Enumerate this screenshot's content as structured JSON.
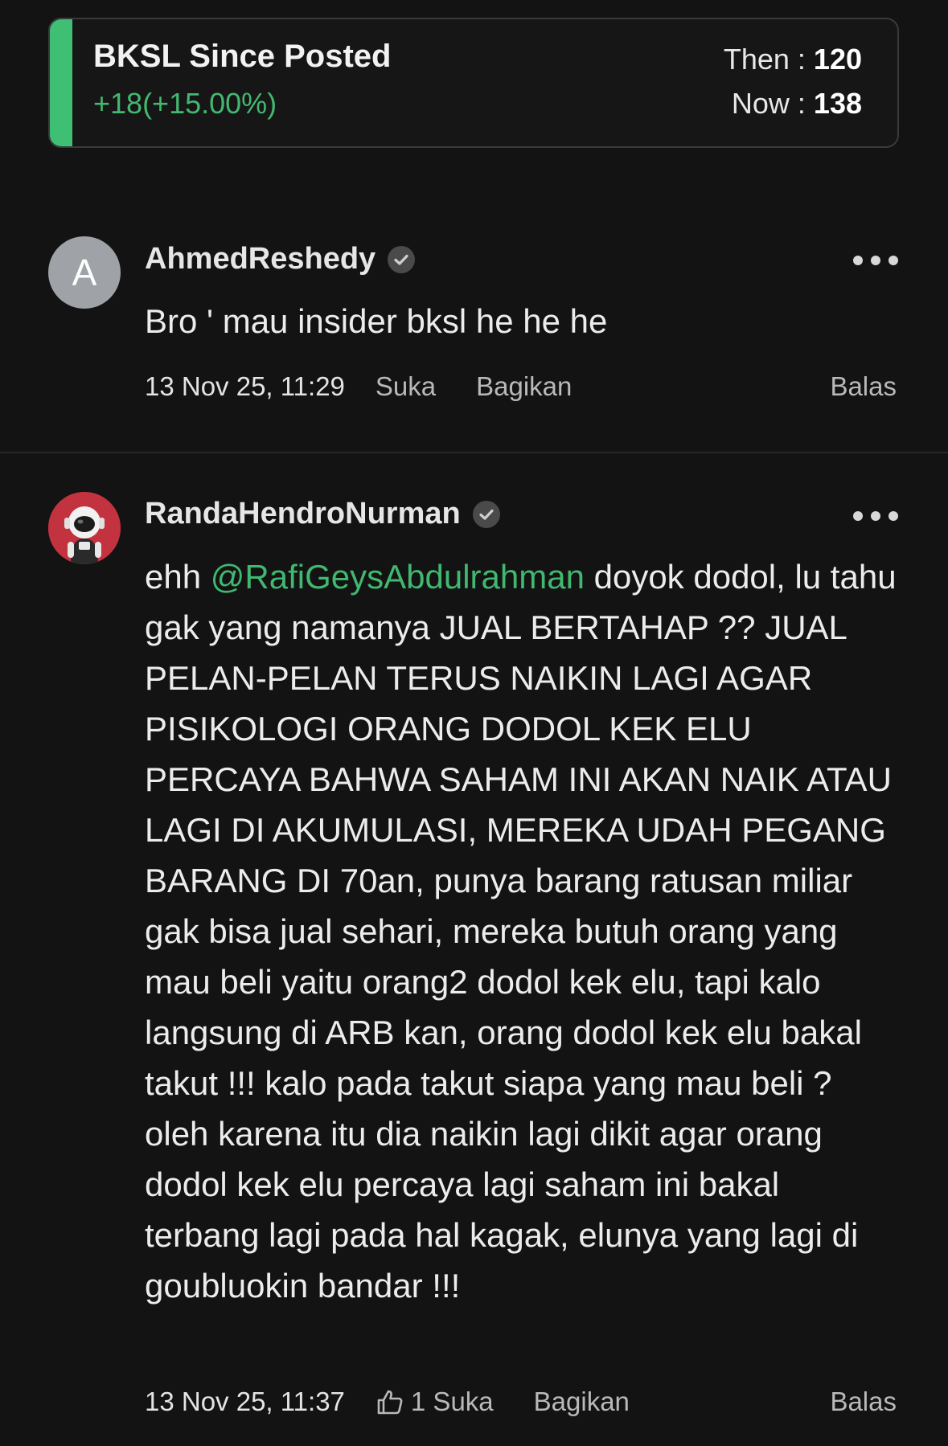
{
  "stock_card": {
    "title": "BKSL Since Posted",
    "change": "+18(+15.00%)",
    "then_label": "Then : ",
    "then_value": "120",
    "now_label": "Now : ",
    "now_value": "138",
    "accent_color": "#3fbf74"
  },
  "comments": [
    {
      "avatar_letter": "A",
      "username": "AhmedReshedy",
      "verified_icon": "verified-check-icon",
      "text": "Bro ' mau insider bksl he he he",
      "timestamp": "13 Nov 25, 11:29",
      "like_label": "Suka",
      "share_label": "Bagikan",
      "reply_label": "Balas"
    },
    {
      "avatar_icon": "astronaut-avatar",
      "username": "RandaHendroNurman",
      "verified_icon": "verified-check-icon",
      "text_prefix": "ehh ",
      "mention": "@RafiGeysAbdulrahman",
      "text": " doyok dodol, lu tahu gak yang namanya JUAL BERTAHAP ?? JUAL PELAN-PELAN TERUS NAIKIN LAGI AGAR PISIKOLOGI ORANG DODOL KEK ELU PERCAYA BAHWA SAHAM INI AKAN NAIK ATAU LAGI DI AKUMULASI, MEREKA UDAH PEGANG BARANG DI 70an, punya barang ratusan miliar gak bisa jual sehari, mereka butuh orang yang mau beli yaitu orang2 dodol kek elu, tapi kalo langsung di ARB kan, orang dodol kek elu bakal takut !!! kalo pada takut siapa yang mau beli ? oleh karena itu dia naikin lagi dikit agar orang dodol kek elu percaya lagi saham ini bakal terbang lagi pada hal kagak, elunya yang lagi di goubluokin bandar !!!",
      "timestamp": "13 Nov 25, 11:37",
      "like_icon": "thumbs-up-icon",
      "like_label": "1 Suka",
      "share_label": "Bagikan",
      "reply_label": "Balas"
    }
  ],
  "colors": {
    "background": "#131313",
    "mention": "#41b870",
    "positive": "#43b86f"
  }
}
